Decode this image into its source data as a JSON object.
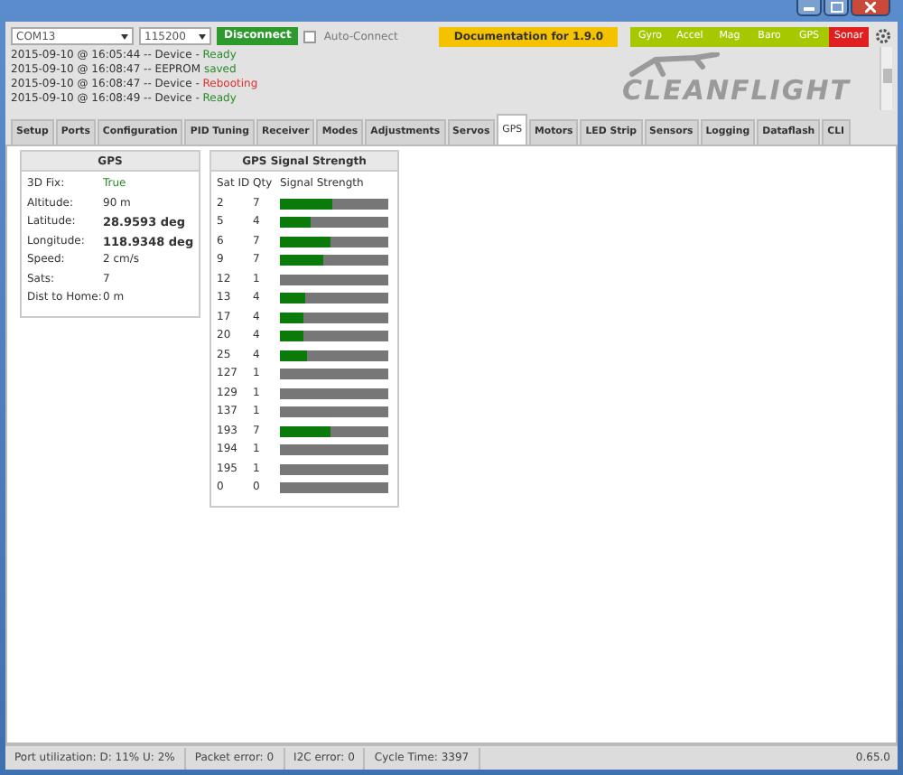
{
  "toolbar": {
    "port": "COM13",
    "baud": "115200",
    "connect_button": "Disconnect",
    "auto_connect": {
      "label": "Auto-Connect",
      "checked": false
    },
    "documentation": "Documentation for 1.9.0",
    "sensors": [
      {
        "label": "Gyro",
        "on": true
      },
      {
        "label": "Accel",
        "on": true
      },
      {
        "label": "Mag",
        "on": true
      },
      {
        "label": "Baro",
        "on": true
      },
      {
        "label": "GPS",
        "on": true
      },
      {
        "label": "Sonar",
        "on": false
      }
    ]
  },
  "log": [
    {
      "text": "2015-09-10 @ 16:05:44 -- Device - ",
      "status": "Ready",
      "kind": "ok"
    },
    {
      "text": "2015-09-10 @ 16:08:47 -- EEPROM ",
      "status": "saved",
      "kind": "ok"
    },
    {
      "text": "2015-09-10 @ 16:08:47 -- Device - ",
      "status": "Rebooting",
      "kind": "error"
    },
    {
      "text": "2015-09-10 @ 16:08:49 -- Device - ",
      "status": "Ready",
      "kind": "ok"
    }
  ],
  "logo": "CLEANFLIGHT",
  "tabs": [
    {
      "label": "Setup",
      "selected": false
    },
    {
      "label": "Ports",
      "selected": false
    },
    {
      "label": "Configuration",
      "selected": false
    },
    {
      "label": "PID Tuning",
      "selected": false
    },
    {
      "label": "Receiver",
      "selected": false
    },
    {
      "label": "Modes",
      "selected": false
    },
    {
      "label": "Adjustments",
      "selected": false
    },
    {
      "label": "Servos",
      "selected": false
    },
    {
      "label": "GPS",
      "selected": true
    },
    {
      "label": "Motors",
      "selected": false
    },
    {
      "label": "LED Strip",
      "selected": false
    },
    {
      "label": "Sensors",
      "selected": false
    },
    {
      "label": "Logging",
      "selected": false
    },
    {
      "label": "Dataflash",
      "selected": false
    },
    {
      "label": "CLI",
      "selected": false
    }
  ],
  "gps_panel": {
    "title": "GPS",
    "rows": [
      {
        "label": "3D Fix:",
        "value": "True",
        "kind": "good"
      },
      {
        "label": "Altitude:",
        "value": "90 m",
        "kind": "plain"
      },
      {
        "label": "Latitude:",
        "value": "28.9593 deg",
        "kind": "bold"
      },
      {
        "label": "Longitude:",
        "value": "118.9348 deg",
        "kind": "bold"
      },
      {
        "label": "Speed:",
        "value": "2 cm/s",
        "kind": "plain"
      },
      {
        "label": "Sats:",
        "value": "7",
        "kind": "plain"
      },
      {
        "label": "Dist to Home:",
        "value": "0 m",
        "kind": "plain"
      }
    ]
  },
  "signal_panel": {
    "title": "GPS Signal Strength",
    "columns": [
      "Sat ID",
      "Qty",
      "Signal Strength"
    ],
    "rows": [
      {
        "sat_id": "2",
        "qty": "7",
        "level": 0.48
      },
      {
        "sat_id": "5",
        "qty": "4",
        "level": 0.29
      },
      {
        "sat_id": "6",
        "qty": "7",
        "level": 0.47
      },
      {
        "sat_id": "9",
        "qty": "7",
        "level": 0.4
      },
      {
        "sat_id": "12",
        "qty": "1",
        "level": 0
      },
      {
        "sat_id": "13",
        "qty": "4",
        "level": 0.24
      },
      {
        "sat_id": "17",
        "qty": "4",
        "level": 0.22
      },
      {
        "sat_id": "20",
        "qty": "4",
        "level": 0.22
      },
      {
        "sat_id": "25",
        "qty": "4",
        "level": 0.25
      },
      {
        "sat_id": "127",
        "qty": "1",
        "level": 0
      },
      {
        "sat_id": "129",
        "qty": "1",
        "level": 0
      },
      {
        "sat_id": "137",
        "qty": "1",
        "level": 0
      },
      {
        "sat_id": "193",
        "qty": "7",
        "level": 0.47
      },
      {
        "sat_id": "194",
        "qty": "1",
        "level": 0
      },
      {
        "sat_id": "195",
        "qty": "1",
        "level": 0
      },
      {
        "sat_id": "0",
        "qty": "0",
        "level": 0
      }
    ]
  },
  "status_bar": {
    "items": [
      "Port utilization: D: 11% U: 2%",
      "Packet error: 0",
      "I2C error: 0",
      "Cycle Time: 3397"
    ],
    "version": "0.65.0"
  }
}
